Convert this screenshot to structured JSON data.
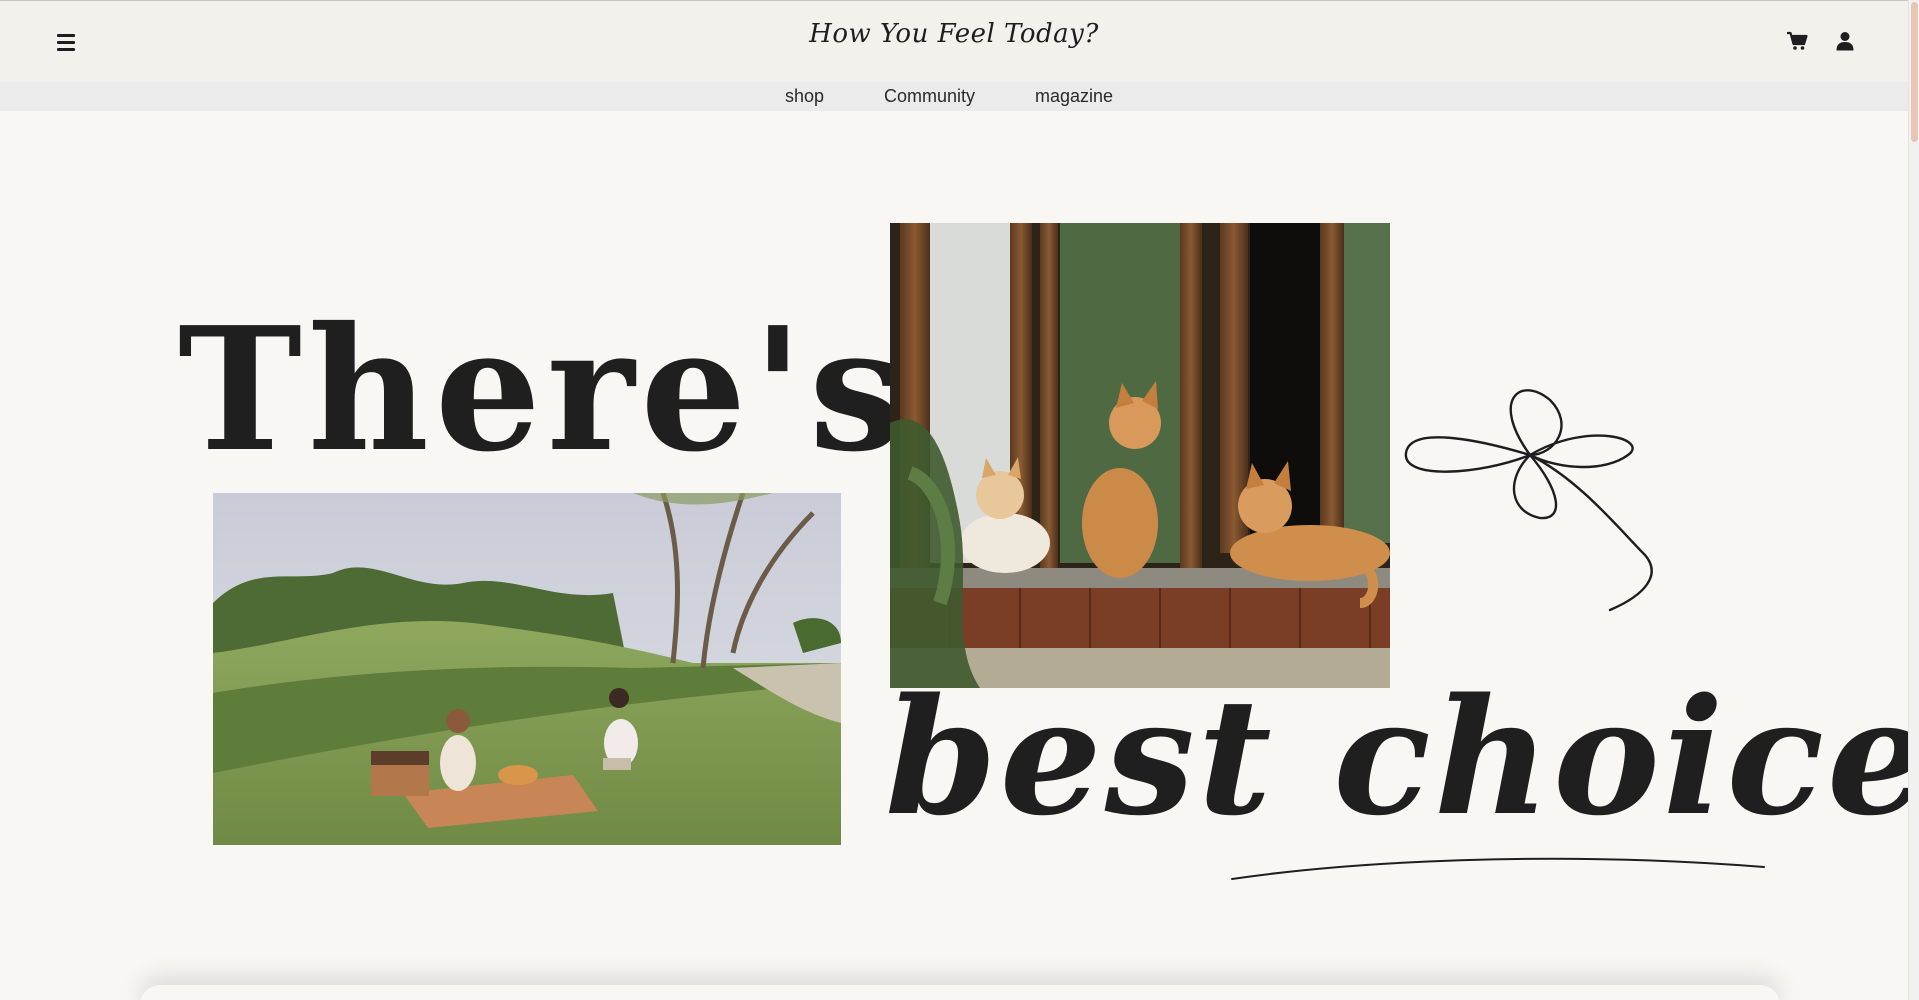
{
  "header": {
    "logo_text": "How You Feel Today?",
    "menu_icon": "hamburger-menu-icon",
    "cart_icon": "shopping-cart-icon",
    "user_icon": "user-account-icon"
  },
  "nav": {
    "items": [
      {
        "label": "shop"
      },
      {
        "label": "Community"
      },
      {
        "label": "magazine"
      }
    ]
  },
  "hero": {
    "headline_line1": "There's a",
    "headline_line2": "best choice."
  },
  "colors": {
    "background": "#f8f7f4",
    "header_bg": "#f2f1ec",
    "nav_bg": "#ebebeb",
    "text": "#1f1e1e",
    "scroll_thumb": "#e8c7b2"
  }
}
